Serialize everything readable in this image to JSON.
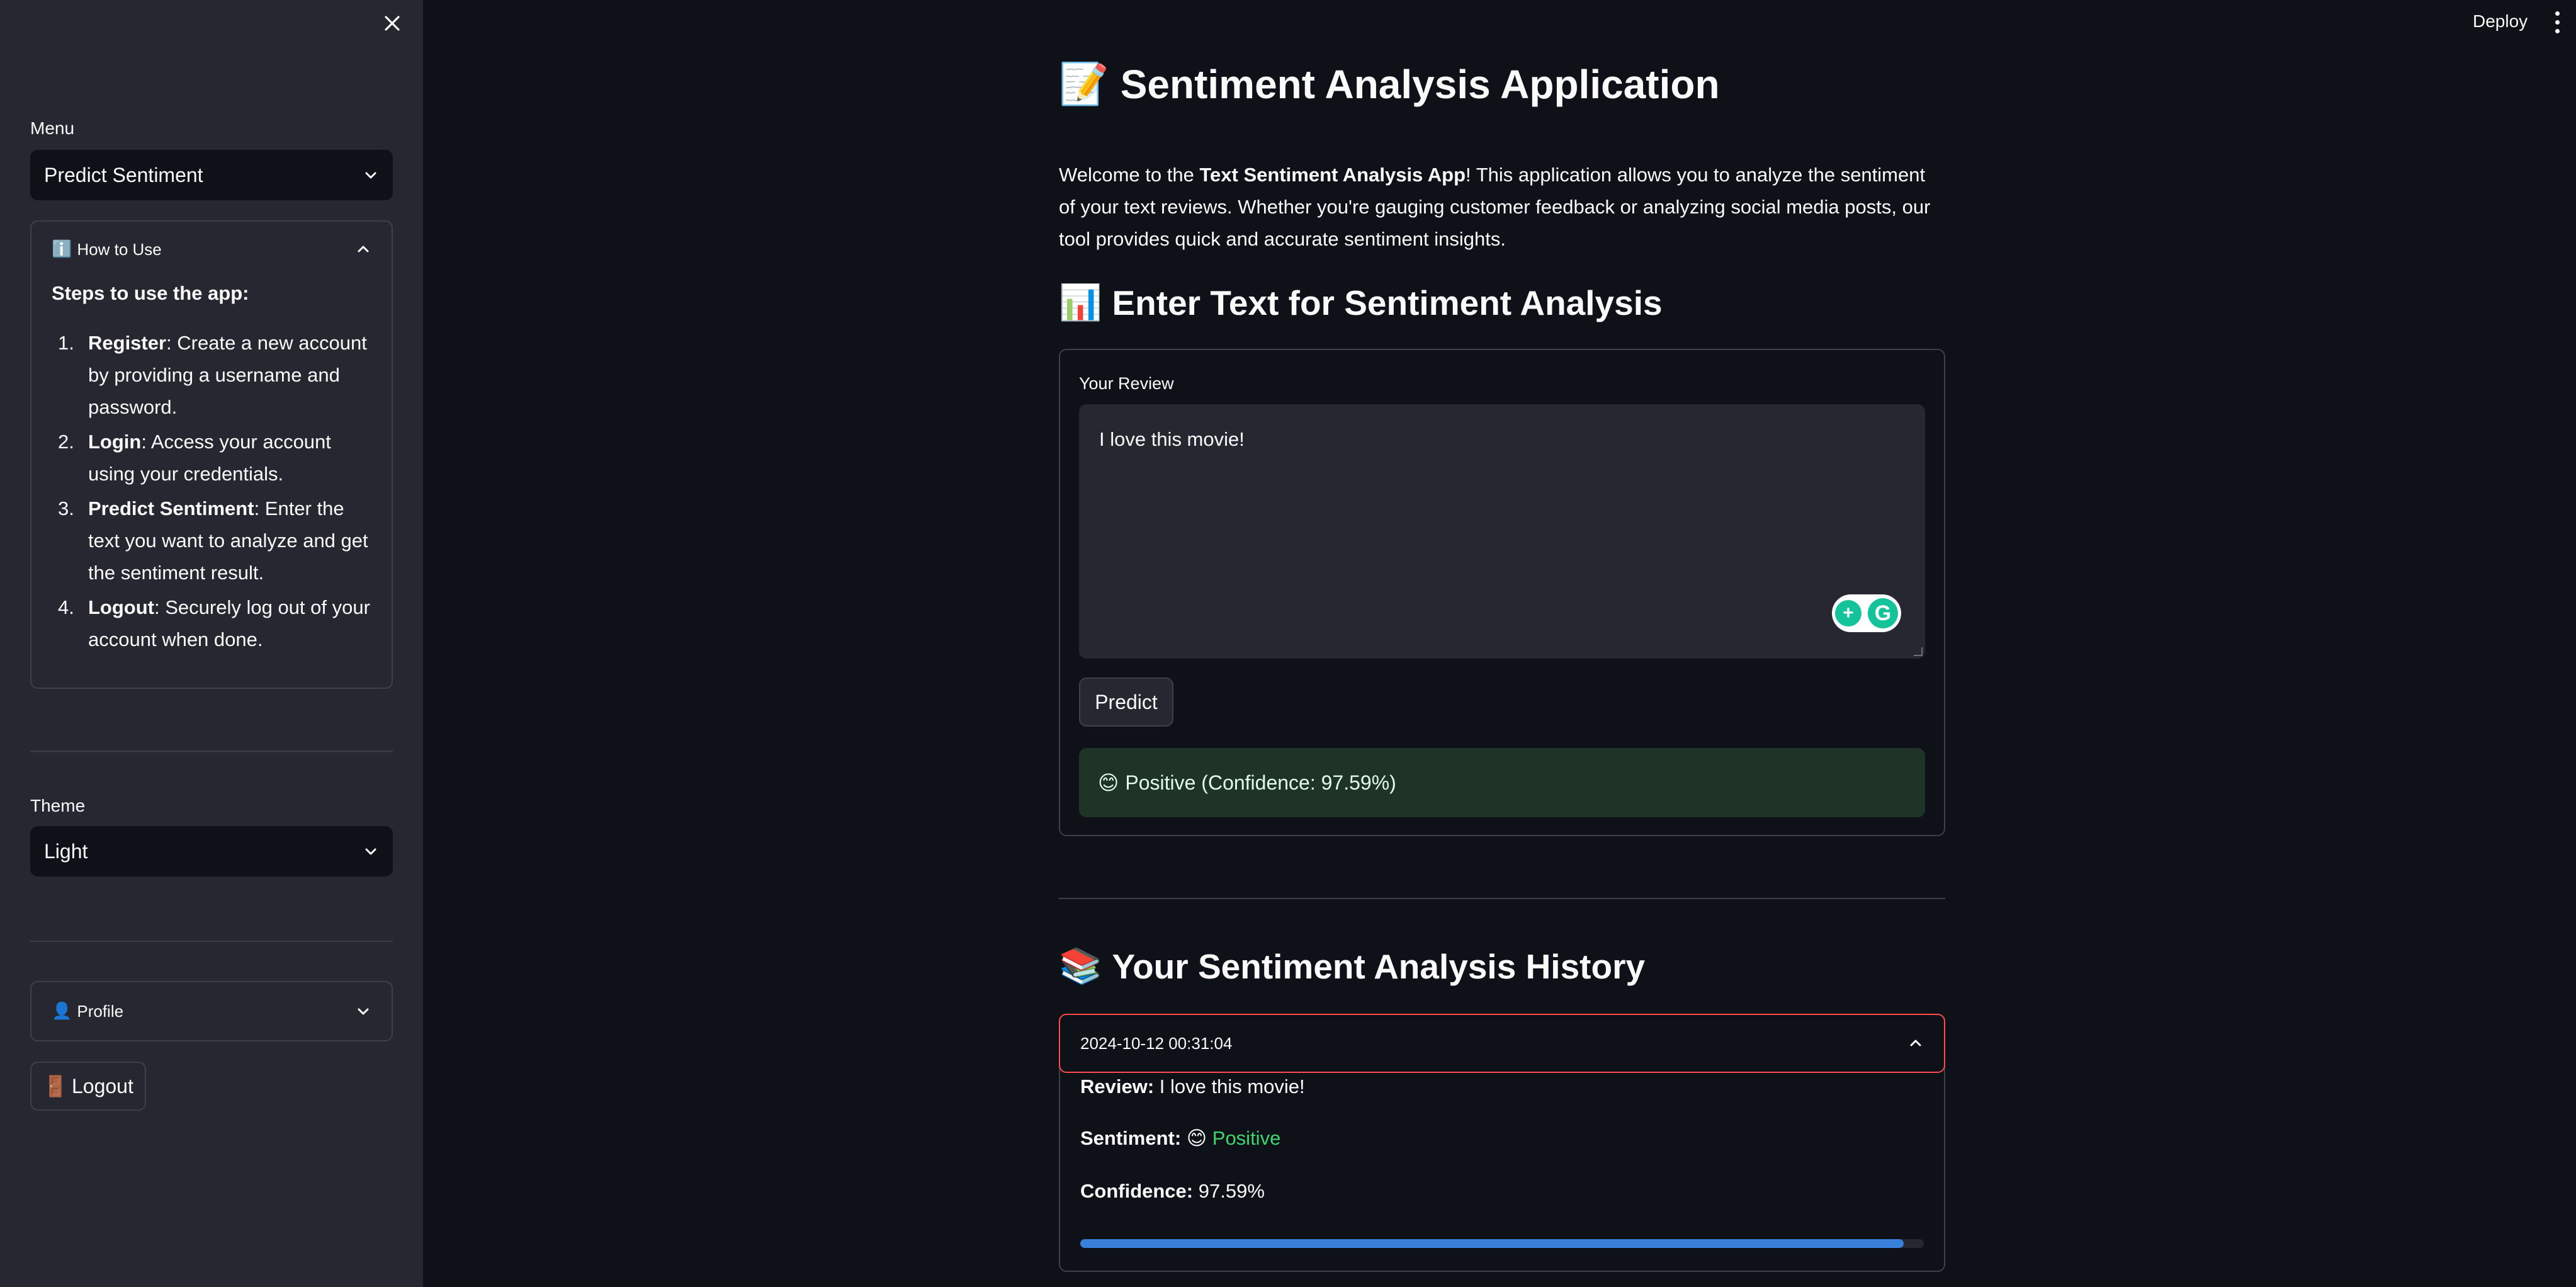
{
  "sidebar": {
    "menu_label": "Menu",
    "menu_value": "Predict Sentiment",
    "how_to_use": {
      "icon": "ℹ️",
      "title": "How to Use",
      "steps_title": "Steps to use the app:",
      "steps": [
        {
          "num": "1.",
          "bold": "Register",
          "text": ": Create a new account by providing a username and password."
        },
        {
          "num": "2.",
          "bold": "Login",
          "text": ": Access your account using your credentials."
        },
        {
          "num": "3.",
          "bold": "Predict Sentiment",
          "text": ": Enter the text you want to analyze and get the sentiment result."
        },
        {
          "num": "4.",
          "bold": "Logout",
          "text": ": Securely log out of your account when done."
        }
      ]
    },
    "theme_label": "Theme",
    "theme_value": "Light",
    "profile": {
      "icon": "👤",
      "title": "Profile"
    },
    "logout": {
      "icon": "🚪",
      "label": "Logout"
    }
  },
  "header": {
    "deploy_label": "Deploy"
  },
  "main": {
    "title_icon": "📝",
    "title": "Sentiment Analysis Application",
    "intro_prefix": "Welcome to the ",
    "intro_bold": "Text Sentiment Analysis App",
    "intro_suffix": "! This application allows you to analyze the sentiment of your text reviews. Whether you're gauging customer feedback or analyzing social media posts, our tool provides quick and accurate sentiment insights.",
    "enter_icon": "📊",
    "enter_heading": "Enter Text for Sentiment Analysis",
    "review_label": "Your Review",
    "review_value": "I love this movie!",
    "predict_label": "Predict",
    "result_icon": "😊",
    "result_text": "Positive (Confidence: 97.59%)",
    "history_icon": "📚",
    "history_heading": "Your Sentiment Analysis History",
    "history": [
      {
        "timestamp": "2024-10-12 00:31:04",
        "review_label": "Review:",
        "review": "I love this movie!",
        "sentiment_label": "Sentiment:",
        "sentiment_icon": "😊",
        "sentiment": "Positive",
        "confidence_label": "Confidence:",
        "confidence": "97.59%",
        "confidence_fraction": 0.9759
      }
    ]
  },
  "colors": {
    "background": "#0e1117",
    "sidebar": "#262730",
    "accent_red": "#ff4b4b",
    "positive": "#3dd56d",
    "progress": "#3880d9",
    "success_bg": "#1f3327"
  }
}
